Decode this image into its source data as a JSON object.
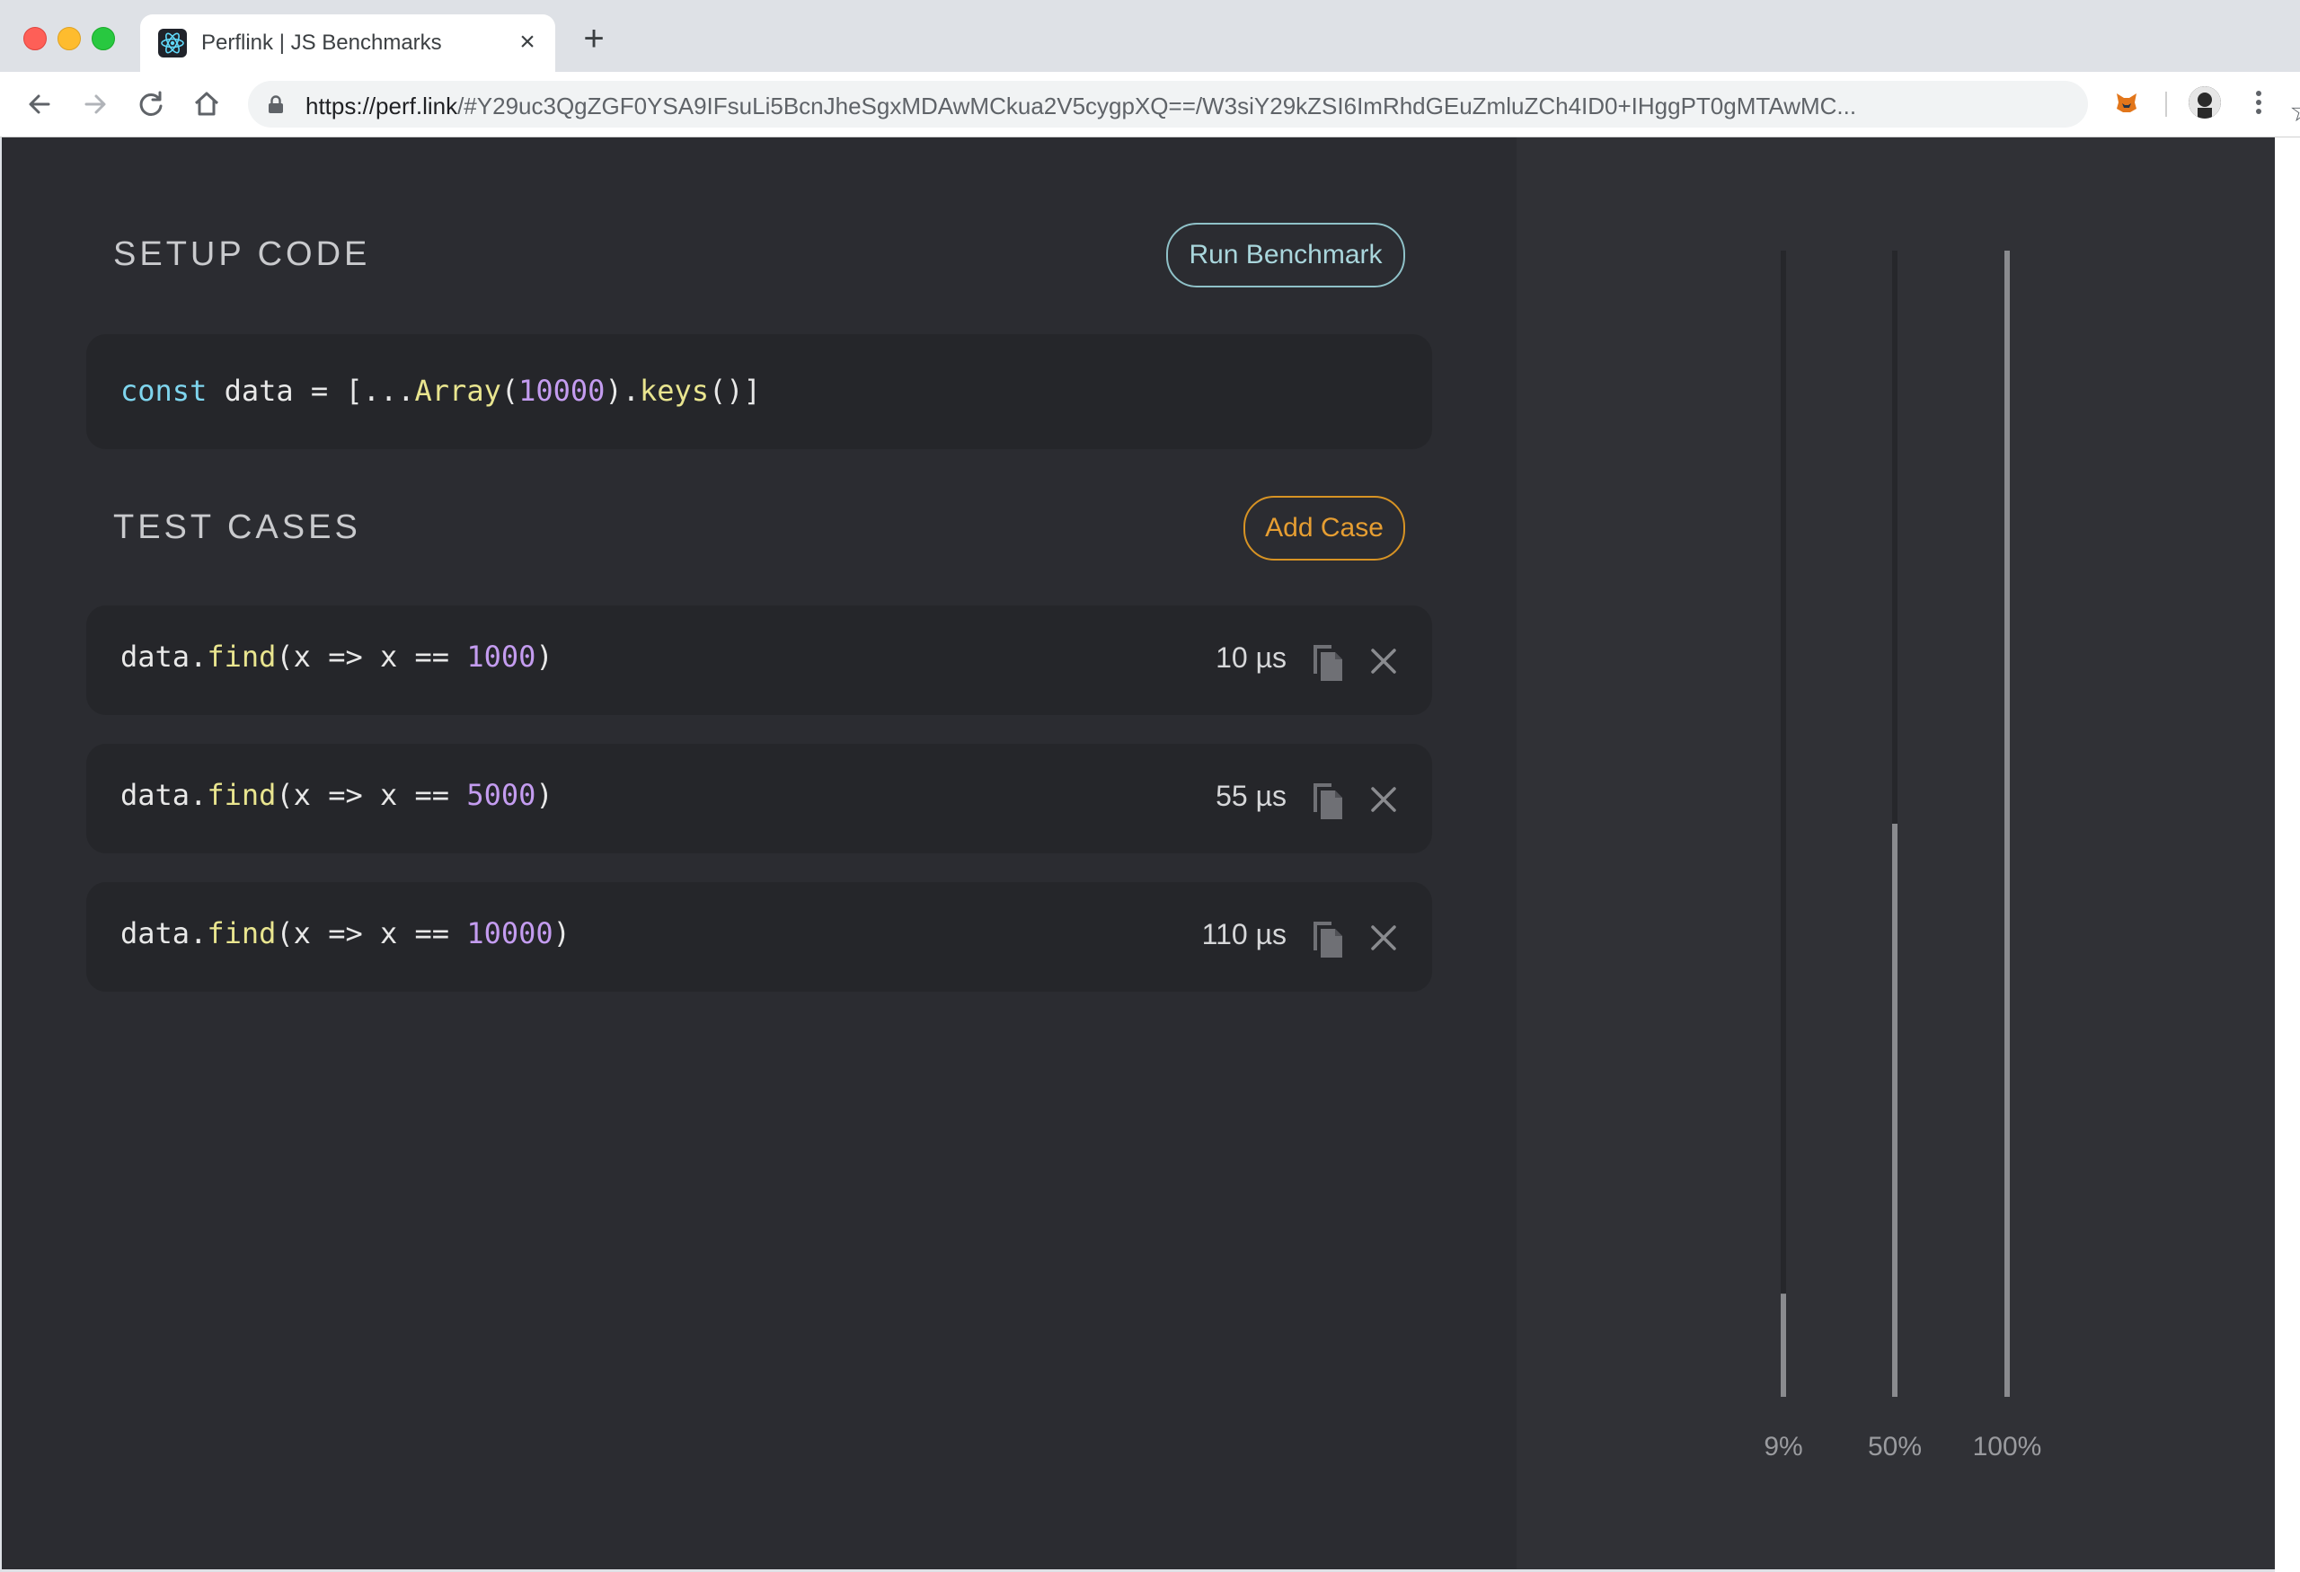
{
  "browser": {
    "tab_title": "Perflink | JS Benchmarks",
    "url_host": "https://perf.link",
    "url_rest": "/#Y29uc3QgZGF0YSA9IFsuLi5BcnJheSgxMDAwMCkua2V5cygpXQ==/W3siY29kZSI6ImRhdGEuZmluZCh4ID0+IHggPT0gMTAwMC...",
    "icons": [
      "back-arrow-icon",
      "forward-arrow-icon",
      "reload-icon",
      "home-icon",
      "lock-icon",
      "star-icon",
      "extension-icon",
      "profile-avatar",
      "menu-dots-icon"
    ]
  },
  "setup": {
    "title": "SETUP CODE",
    "run_button": "Run Benchmark",
    "code": {
      "kw": "const",
      "rest1": " data = [...",
      "fn1": "Array",
      "p1": "(",
      "num": "10000",
      "p2": ").",
      "fn2": "keys",
      "p3": "()]"
    }
  },
  "tests": {
    "title": "TEST CASES",
    "add_button": "Add Case",
    "cases": [
      {
        "prefix": "data.",
        "fn": "find",
        "mid": "(x => x == ",
        "num": "1000",
        "suffix": ")",
        "time": "10 µs"
      },
      {
        "prefix": "data.",
        "fn": "find",
        "mid": "(x => x == ",
        "num": "5000",
        "suffix": ")",
        "time": "55 µs"
      },
      {
        "prefix": "data.",
        "fn": "find",
        "mid": "(x => x == ",
        "num": "10000",
        "suffix": ")",
        "time": "110 µs"
      }
    ]
  },
  "chart_data": {
    "type": "bar",
    "categories": [
      "9%",
      "50%",
      "100%"
    ],
    "values": [
      9,
      50,
      100
    ],
    "ylim": [
      0,
      100
    ],
    "title": "",
    "xlabel": "",
    "ylabel": "",
    "grid": false,
    "colors": {
      "track": "#26272b",
      "bar": "#8a8b8f",
      "label": "#9a9b9f"
    }
  }
}
